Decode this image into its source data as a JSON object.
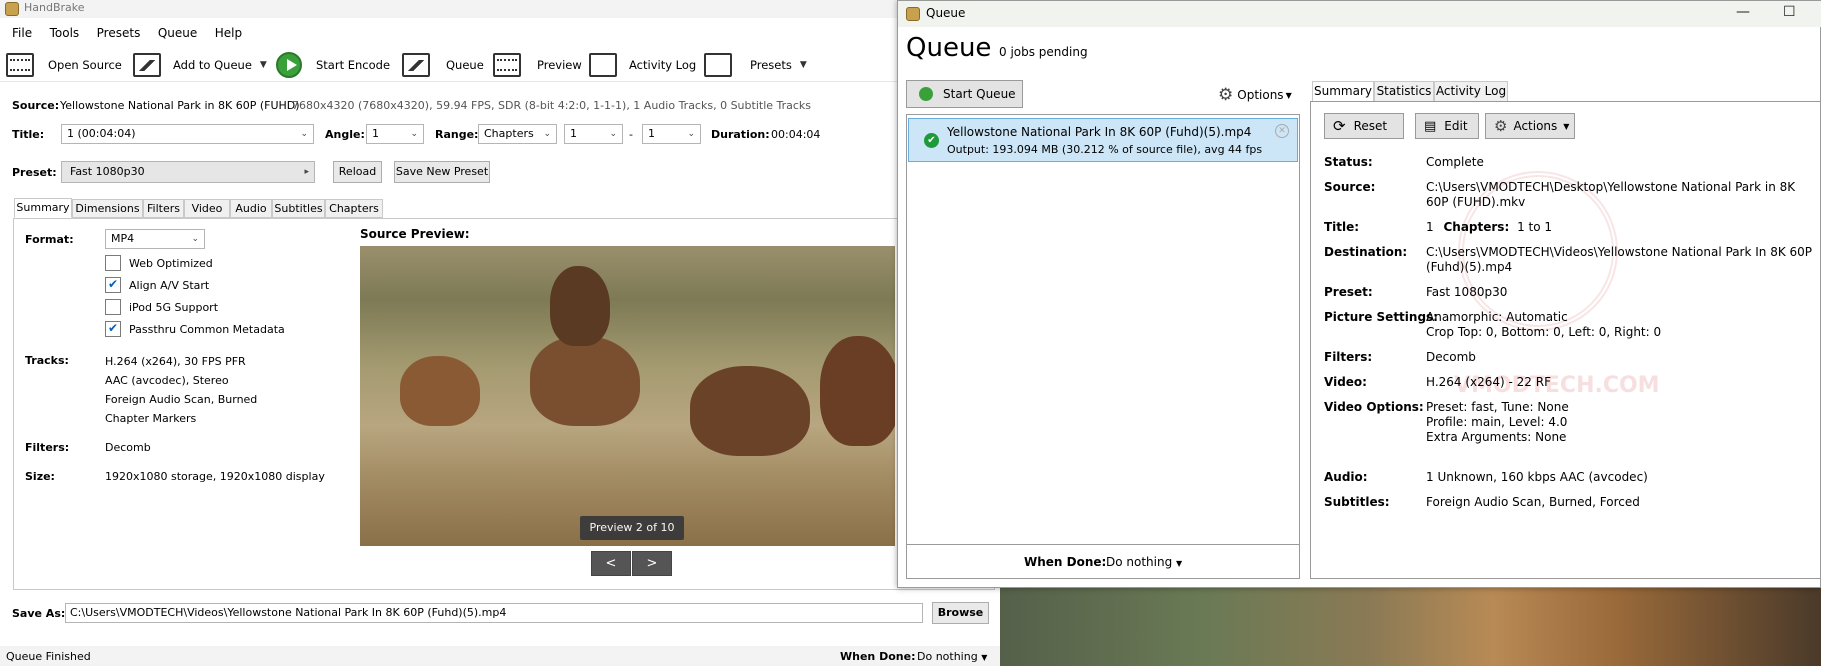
{
  "main": {
    "window_title": "HandBrake",
    "menu": [
      "File",
      "Tools",
      "Presets",
      "Queue",
      "Help"
    ],
    "toolbar": {
      "open_source": "Open Source",
      "add_to_queue": "Add to Queue",
      "start_encode": "Start Encode",
      "queue": "Queue",
      "preview": "Preview",
      "activity_log": "Activity Log",
      "presets": "Presets"
    },
    "source_label": "Source:",
    "source_name": "Yellowstone National Park in 8K 60P (FUHD)",
    "source_info": "7680x4320 (7680x4320), 59.94 FPS, SDR (8-bit 4:2:0, 1-1-1), 1 Audio Tracks, 0 Subtitle Tracks",
    "title_label": "Title:",
    "title_value": "1 (00:04:04)",
    "angle_label": "Angle:",
    "angle_value": "1",
    "range_label": "Range:",
    "range_type": "Chapters",
    "range_start": "1",
    "range_sep": "-",
    "range_end": "1",
    "duration_label": "Duration:",
    "duration_value": "00:04:04",
    "preset_label": "Preset:",
    "preset_value": "Fast 1080p30",
    "reload_label": "Reload",
    "save_new_preset_label": "Save New Preset",
    "tabs": [
      "Summary",
      "Dimensions",
      "Filters",
      "Video",
      "Audio",
      "Subtitles",
      "Chapters"
    ],
    "summary": {
      "format_label": "Format:",
      "format_value": "MP4",
      "options": [
        {
          "label": "Web Optimized",
          "checked": false
        },
        {
          "label": "Align A/V Start",
          "checked": true
        },
        {
          "label": "iPod 5G Support",
          "checked": false
        },
        {
          "label": "Passthru Common Metadata",
          "checked": true
        }
      ],
      "tracks_label": "Tracks:",
      "tracks": [
        "H.264 (x264), 30 FPS PFR",
        "AAC (avcodec), Stereo",
        "Foreign Audio Scan, Burned",
        "Chapter Markers"
      ],
      "filters_label": "Filters:",
      "filters_value": "Decomb",
      "size_label": "Size:",
      "size_value": "1920x1080 storage, 1920x1080 display",
      "source_preview_label": "Source Preview:",
      "preview_counter": "Preview 2 of 10",
      "prev_btn": "<",
      "next_btn": ">"
    },
    "save_as_label": "Save As:",
    "save_as_path": "C:\\Users\\VMODTECH\\Videos\\Yellowstone National Park In 8K 60P (Fuhd)(5).mp4",
    "browse_label": "Browse",
    "status_text": "Queue Finished",
    "when_done_label": "When Done:",
    "when_done_value": "Do nothing"
  },
  "queue": {
    "window_title": "Queue",
    "heading": "Queue",
    "pending": "0 jobs pending",
    "start_queue_label": "Start Queue",
    "options_label": "Options",
    "job": {
      "name": "Yellowstone National Park In 8K 60P (Fuhd)(5).mp4",
      "output": "Output: 193.094 MB (30.212 % of source file), avg 44 fps"
    },
    "when_done_label": "When Done:",
    "when_done_value": "Do nothing",
    "tabs": [
      "Summary",
      "Statistics",
      "Activity Log"
    ],
    "reset_label": "Reset",
    "edit_label": "Edit",
    "actions_label": "Actions",
    "details": {
      "status_label": "Status:",
      "status": "Complete",
      "source_label": "Source:",
      "source": "C:\\Users\\VMODTECH\\Desktop\\Yellowstone National Park in 8K 60P (FUHD).mkv",
      "title_label": "Title:",
      "title": "1",
      "chapters_label": "Chapters:",
      "chapters": "1 to 1",
      "destination_label": "Destination:",
      "destination": "C:\\Users\\VMODTECH\\Videos\\Yellowstone National Park In 8K 60P (Fuhd)(5).mp4",
      "preset_label": "Preset:",
      "preset": "Fast 1080p30",
      "picture_label": "Picture Settings:",
      "picture_1": "Anamorphic: Automatic",
      "picture_2": "Crop Top: 0, Bottom: 0, Left: 0, Right: 0",
      "filters_label": "Filters:",
      "filters": "Decomb",
      "video_label": "Video:",
      "video": "H.264 (x264) - 22 RF",
      "video_options_label": "Video Options:",
      "video_options_1": "Preset: fast, Tune: None",
      "video_options_2": "Profile: main, Level: 4.0",
      "video_options_3": "Extra Arguments: None",
      "audio_label": "Audio:",
      "audio": "1 Unknown, 160 kbps AAC (avcodec)",
      "subtitles_label": "Subtitles:",
      "subtitles": "Foreign Audio Scan, Burned, Forced"
    },
    "watermark": "VMODTECH.COM"
  }
}
